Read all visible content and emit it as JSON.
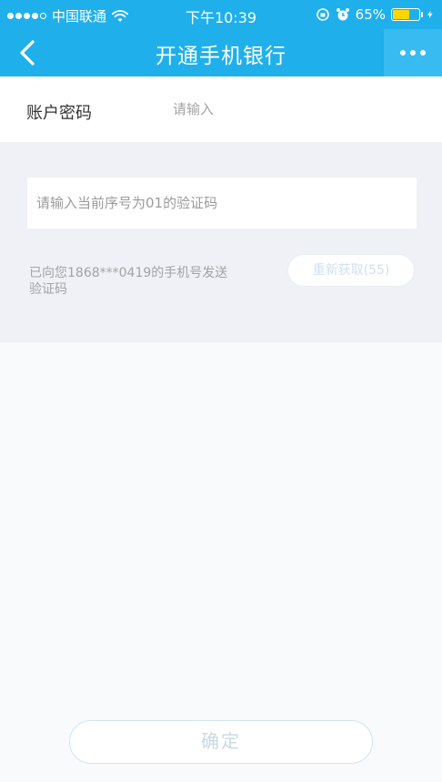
{
  "status_bar": {
    "carrier": "中国联通",
    "time": "下午10:39",
    "battery_percent": "65%",
    "battery_level": 0.65
  },
  "nav": {
    "title": "开通手机银行",
    "back_icon": "chevron-left-icon",
    "more_icon": "more-dots-icon"
  },
  "password": {
    "label": "账户密码",
    "placeholder": "请输入",
    "value": ""
  },
  "verification": {
    "placeholder": "请输入当前序号为01的验证码",
    "value": "",
    "sent_info": "已向您1868***0419的手机号发送验证码",
    "resend_label": "重新获取(55)"
  },
  "confirm_label": "确定",
  "colors": {
    "brand": "#1fb0ec",
    "section_bg": "#eff1f6"
  }
}
